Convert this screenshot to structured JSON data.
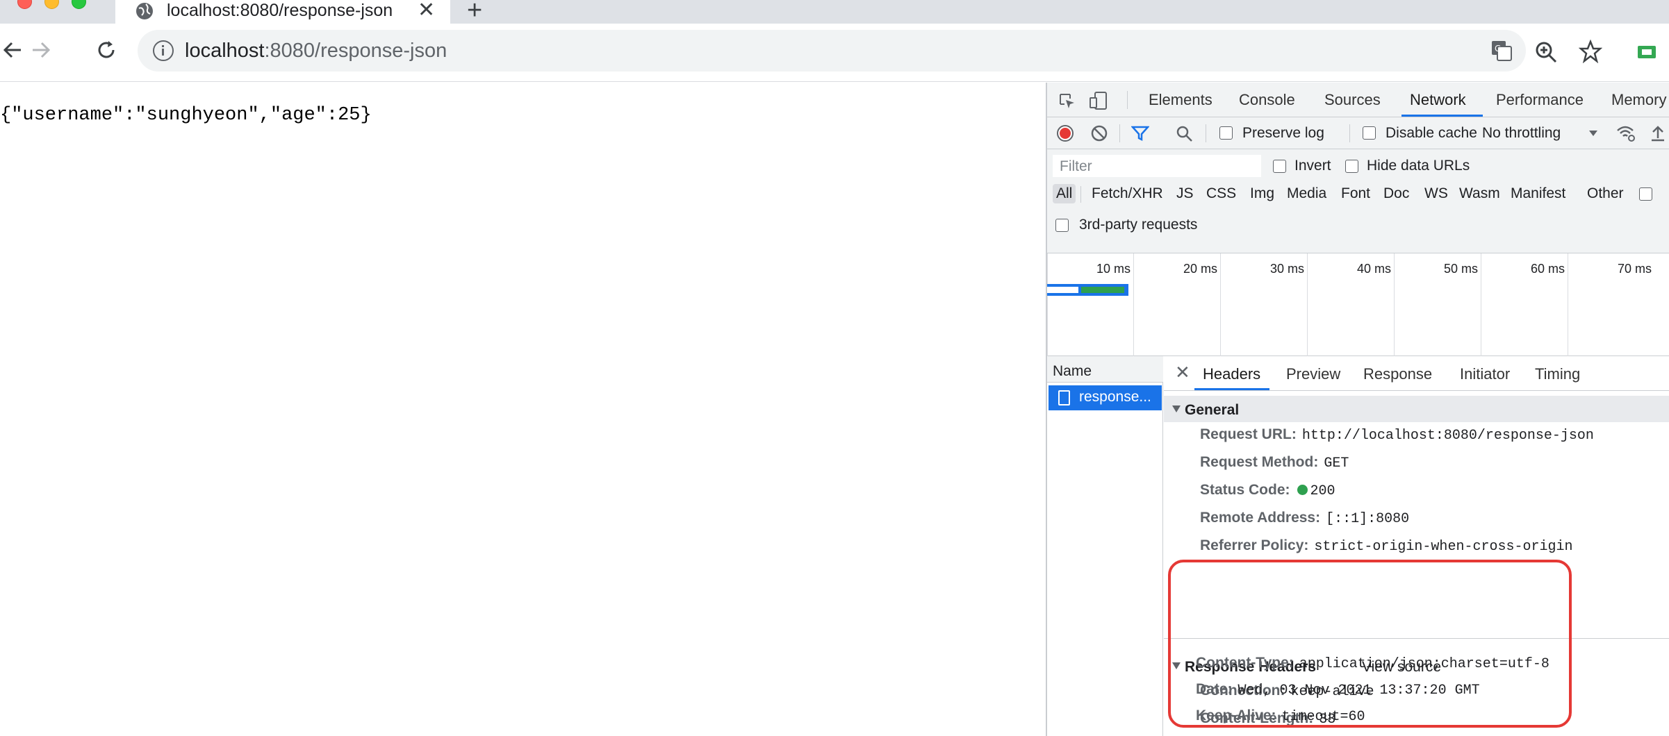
{
  "browser": {
    "tab_title": "localhost:8080/response-json",
    "tab_close": "✕",
    "new_tab": "+",
    "url_host": "localhost",
    "url_path": ":8080/response-json"
  },
  "page": {
    "json_body": "{\"username\":\"sunghyeon\",\"age\":25}"
  },
  "devtools": {
    "tabs": [
      "Elements",
      "Console",
      "Sources",
      "Network",
      "Performance",
      "Memory"
    ],
    "active_tab": "Network",
    "toolbar": {
      "preserve_log": "Preserve log",
      "disable_cache": "Disable cache",
      "throttling": "No throttling"
    },
    "filter": {
      "placeholder": "Filter",
      "invert": "Invert",
      "hide_data_urls": "Hide data URLs",
      "third_party": "3rd-party requests"
    },
    "type_filters": [
      "All",
      "Fetch/XHR",
      "JS",
      "CSS",
      "Img",
      "Media",
      "Font",
      "Doc",
      "WS",
      "Wasm",
      "Manifest",
      "Other"
    ],
    "timeline_ticks": [
      "10 ms",
      "20 ms",
      "30 ms",
      "40 ms",
      "50 ms",
      "60 ms",
      "70 ms"
    ],
    "request_list": {
      "header": "Name",
      "rows": [
        "response..."
      ]
    },
    "details": {
      "close": "✕",
      "tabs": [
        "Headers",
        "Preview",
        "Response",
        "Initiator",
        "Timing"
      ],
      "active_tab": "Headers",
      "general": {
        "title": "General",
        "request_url_key": "Request URL:",
        "request_url": "http://localhost:8080/response-json",
        "request_method_key": "Request Method:",
        "request_method": "GET",
        "status_code_key": "Status Code:",
        "status_code": "200",
        "remote_address_key": "Remote Address:",
        "remote_address": "[::1]:8080",
        "referrer_policy_key": "Referrer Policy:",
        "referrer_policy": "strict-origin-when-cross-origin"
      },
      "response_headers": {
        "title": "Response Headers",
        "view_source": "View source",
        "connection_key": "Connection:",
        "connection": "keep-alive",
        "content_length_key": "Content-Length:",
        "content_length": "33",
        "content_type_key": "Content-Type:",
        "content_type": "application/json;charset=utf-8",
        "date_key": "Date:",
        "date": "Wed, 03 Nov 2021 13:37:20 GMT",
        "keep_alive_key": "Keep-Alive:",
        "keep_alive": "timeout=60"
      }
    }
  },
  "colors": {
    "accent": "#1a73e8",
    "status_ok": "#2ea04f",
    "record": "#e53935",
    "highlight": "#e53935"
  }
}
